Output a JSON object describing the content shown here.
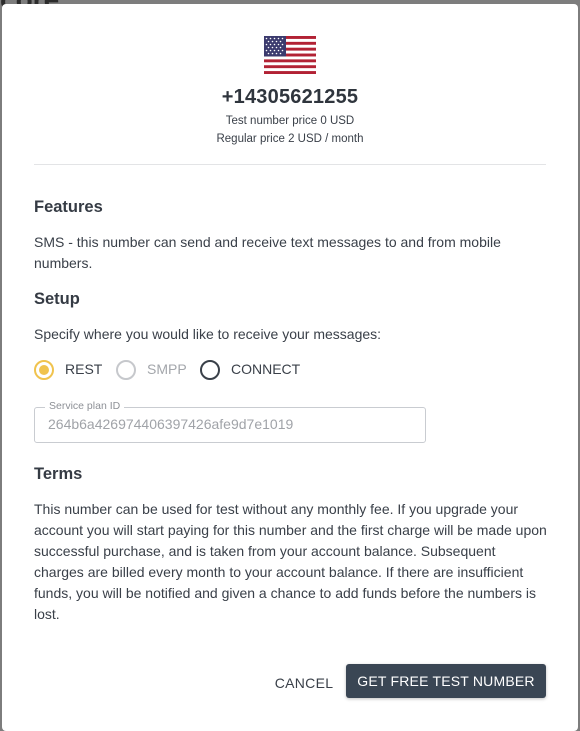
{
  "background": {
    "partial_text": "core"
  },
  "number": {
    "flag_icon": "us-flag-icon",
    "phone": "+14305621255",
    "test_price": "Test number price 0 USD",
    "regular_price": "Regular price 2 USD / month"
  },
  "features": {
    "heading": "Features",
    "text": "SMS - this number can send and receive text messages to and from mobile numbers."
  },
  "setup": {
    "heading": "Setup",
    "prompt": "Specify where you would like to receive your messages:",
    "options": [
      {
        "label": "REST",
        "state": "checked"
      },
      {
        "label": "SMPP",
        "state": "disabled"
      },
      {
        "label": "CONNECT",
        "state": "unchecked"
      }
    ],
    "service_plan": {
      "label": "Service plan ID",
      "value": "264b6a426974406397426afe9d7e1019"
    }
  },
  "terms": {
    "heading": "Terms",
    "text": "This number can be used for test without any monthly fee. If you upgrade your account you will start paying for this number and the first charge will be made upon successful purchase, and is taken from your account balance. Subsequent charges are billed every month to your account balance. If there are insufficient funds, you will be notified and given a chance to add funds before the numbers is lost."
  },
  "actions": {
    "cancel": "CANCEL",
    "confirm": "GET FREE TEST NUMBER"
  },
  "colors": {
    "accent_radio": "#f0c34e",
    "primary_button": "#3a4654",
    "text": "#3a4049"
  }
}
